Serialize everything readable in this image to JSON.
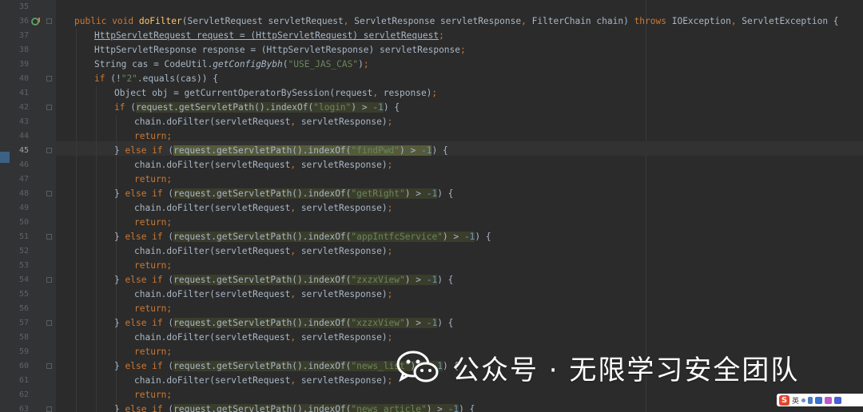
{
  "editor": {
    "current_line": "45",
    "lines": [
      {
        "n": "35",
        "indent": 0,
        "fold": false,
        "segs": []
      },
      {
        "n": "36",
        "indent": 1,
        "fold": true,
        "override": true,
        "segs": [
          {
            "t": "public void ",
            "c": "kw"
          },
          {
            "t": "doFilter",
            "c": "fn"
          },
          {
            "t": "(ServletRequest servletRequest"
          },
          {
            "t": ", ",
            "c": "kw"
          },
          {
            "t": "ServletResponse servletResponse"
          },
          {
            "t": ", ",
            "c": "kw"
          },
          {
            "t": "FilterChain chain) "
          },
          {
            "t": "throws ",
            "c": "kw"
          },
          {
            "t": "IOException"
          },
          {
            "t": ", ",
            "c": "kw"
          },
          {
            "t": "ServletException {"
          }
        ]
      },
      {
        "n": "37",
        "indent": 2,
        "fold": false,
        "segs": [
          {
            "t": "HttpServletRequest request = (HttpServletRequest) servletRequest",
            "c": "ul"
          },
          {
            "t": ";",
            "c": "kw"
          }
        ]
      },
      {
        "n": "38",
        "indent": 2,
        "fold": false,
        "segs": [
          {
            "t": "HttpServletResponse response = (HttpServletResponse) servletResponse"
          },
          {
            "t": ";",
            "c": "kw"
          }
        ]
      },
      {
        "n": "39",
        "indent": 2,
        "fold": false,
        "segs": [
          {
            "t": "String cas = CodeUtil."
          },
          {
            "t": "getConfigBybh",
            "c": "it"
          },
          {
            "t": "("
          },
          {
            "t": "\"USE_JAS_CAS\"",
            "c": "str"
          },
          {
            "t": ")"
          },
          {
            "t": ";",
            "c": "kw"
          }
        ]
      },
      {
        "n": "40",
        "indent": 2,
        "fold": true,
        "segs": [
          {
            "t": "if ",
            "c": "kw"
          },
          {
            "t": "(!"
          },
          {
            "t": "\"2\"",
            "c": "str"
          },
          {
            "t": ".equals(cas)) {"
          }
        ]
      },
      {
        "n": "41",
        "indent": 3,
        "fold": false,
        "segs": [
          {
            "t": "Object obj = getCurrentOperatorBySession(request"
          },
          {
            "t": ", ",
            "c": "kw"
          },
          {
            "t": "response)"
          },
          {
            "t": ";",
            "c": "kw"
          }
        ]
      },
      {
        "n": "42",
        "indent": 3,
        "fold": true,
        "segs": [
          {
            "t": "if ",
            "c": "kw"
          },
          {
            "t": "("
          },
          {
            "t": "request.getServletPath().indexOf(",
            "h": 1
          },
          {
            "t": "\"login\"",
            "c": "str",
            "h": 1
          },
          {
            "t": ") > ",
            "h": 1
          },
          {
            "t": "-1",
            "c": "num",
            "h": 1
          },
          {
            "t": ") {"
          }
        ]
      },
      {
        "n": "43",
        "indent": 4,
        "fold": false,
        "segs": [
          {
            "t": "chain.doFilter(servletRequest"
          },
          {
            "t": ", ",
            "c": "kw"
          },
          {
            "t": "servletResponse)"
          },
          {
            "t": ";",
            "c": "kw"
          }
        ]
      },
      {
        "n": "44",
        "indent": 4,
        "fold": false,
        "segs": [
          {
            "t": "return;",
            "c": "kw"
          }
        ]
      },
      {
        "n": "45",
        "indent": 3,
        "fold": true,
        "segs": [
          {
            "t": "} "
          },
          {
            "t": "else if ",
            "c": "kw"
          },
          {
            "t": "("
          },
          {
            "t": "request.getServletPath().indexOf(",
            "h": 1
          },
          {
            "t": "\"findPwd\"",
            "c": "str",
            "h": 1
          },
          {
            "t": ") > ",
            "h": 1
          },
          {
            "t": "-1",
            "c": "num",
            "h": 1
          },
          {
            "t": ") {"
          }
        ]
      },
      {
        "n": "46",
        "indent": 4,
        "fold": false,
        "segs": [
          {
            "t": "chain.doFilter(servletRequest"
          },
          {
            "t": ", ",
            "c": "kw"
          },
          {
            "t": "servletResponse)"
          },
          {
            "t": ";",
            "c": "kw"
          }
        ]
      },
      {
        "n": "47",
        "indent": 4,
        "fold": false,
        "segs": [
          {
            "t": "return;",
            "c": "kw"
          }
        ]
      },
      {
        "n": "48",
        "indent": 3,
        "fold": true,
        "segs": [
          {
            "t": "} "
          },
          {
            "t": "else if ",
            "c": "kw"
          },
          {
            "t": "("
          },
          {
            "t": "request.getServletPath().indexOf(",
            "h": 1
          },
          {
            "t": "\"getRight\"",
            "c": "str",
            "h": 1
          },
          {
            "t": ") > ",
            "h": 1
          },
          {
            "t": "-1",
            "c": "num",
            "h": 1
          },
          {
            "t": ") {"
          }
        ]
      },
      {
        "n": "49",
        "indent": 4,
        "fold": false,
        "segs": [
          {
            "t": "chain.doFilter(servletRequest"
          },
          {
            "t": ", ",
            "c": "kw"
          },
          {
            "t": "servletResponse)"
          },
          {
            "t": ";",
            "c": "kw"
          }
        ]
      },
      {
        "n": "50",
        "indent": 4,
        "fold": false,
        "segs": [
          {
            "t": "return;",
            "c": "kw"
          }
        ]
      },
      {
        "n": "51",
        "indent": 3,
        "fold": true,
        "segs": [
          {
            "t": "} "
          },
          {
            "t": "else if ",
            "c": "kw"
          },
          {
            "t": "("
          },
          {
            "t": "request.getServletPath().indexOf(",
            "h": 1
          },
          {
            "t": "\"appIntfcService\"",
            "c": "str",
            "h": 1
          },
          {
            "t": ") > ",
            "h": 1
          },
          {
            "t": "-1",
            "c": "num",
            "h": 1
          },
          {
            "t": ") {"
          }
        ]
      },
      {
        "n": "52",
        "indent": 4,
        "fold": false,
        "segs": [
          {
            "t": "chain.doFilter(servletRequest"
          },
          {
            "t": ", ",
            "c": "kw"
          },
          {
            "t": "servletResponse)"
          },
          {
            "t": ";",
            "c": "kw"
          }
        ]
      },
      {
        "n": "53",
        "indent": 4,
        "fold": false,
        "segs": [
          {
            "t": "return;",
            "c": "kw"
          }
        ]
      },
      {
        "n": "54",
        "indent": 3,
        "fold": true,
        "segs": [
          {
            "t": "} "
          },
          {
            "t": "else if ",
            "c": "kw"
          },
          {
            "t": "("
          },
          {
            "t": "request.getServletPath().indexOf(",
            "h": 1
          },
          {
            "t": "\"zxzxView\"",
            "c": "str",
            "h": 1
          },
          {
            "t": ") > ",
            "h": 1
          },
          {
            "t": "-1",
            "c": "num",
            "h": 1
          },
          {
            "t": ") {"
          }
        ]
      },
      {
        "n": "55",
        "indent": 4,
        "fold": false,
        "segs": [
          {
            "t": "chain.doFilter(servletRequest"
          },
          {
            "t": ", ",
            "c": "kw"
          },
          {
            "t": "servletResponse)"
          },
          {
            "t": ";",
            "c": "kw"
          }
        ]
      },
      {
        "n": "56",
        "indent": 4,
        "fold": false,
        "segs": [
          {
            "t": "return;",
            "c": "kw"
          }
        ]
      },
      {
        "n": "57",
        "indent": 3,
        "fold": true,
        "segs": [
          {
            "t": "} "
          },
          {
            "t": "else if ",
            "c": "kw"
          },
          {
            "t": "("
          },
          {
            "t": "request.getServletPath().indexOf(",
            "h": 1
          },
          {
            "t": "\"xzzxView\"",
            "c": "str",
            "h": 1
          },
          {
            "t": ") > ",
            "h": 1
          },
          {
            "t": "-1",
            "c": "num",
            "h": 1
          },
          {
            "t": ") {"
          }
        ]
      },
      {
        "n": "58",
        "indent": 4,
        "fold": false,
        "segs": [
          {
            "t": "chain.doFilter(servletRequest"
          },
          {
            "t": ", ",
            "c": "kw"
          },
          {
            "t": "servletResponse)"
          },
          {
            "t": ";",
            "c": "kw"
          }
        ]
      },
      {
        "n": "59",
        "indent": 4,
        "fold": false,
        "segs": [
          {
            "t": "return;",
            "c": "kw"
          }
        ]
      },
      {
        "n": "60",
        "indent": 3,
        "fold": true,
        "segs": [
          {
            "t": "} "
          },
          {
            "t": "else if ",
            "c": "kw"
          },
          {
            "t": "("
          },
          {
            "t": "request.getServletPath().indexOf(",
            "h": 1
          },
          {
            "t": "\"news_list\"",
            "c": "str",
            "h": 1
          },
          {
            "t": ") > ",
            "h": 1
          },
          {
            "t": "-1",
            "c": "num",
            "h": 1
          },
          {
            "t": ") {"
          }
        ]
      },
      {
        "n": "61",
        "indent": 4,
        "fold": false,
        "segs": [
          {
            "t": "chain.doFilter(servletRequest"
          },
          {
            "t": ", ",
            "c": "kw"
          },
          {
            "t": "servletResponse)"
          },
          {
            "t": ";",
            "c": "kw"
          }
        ]
      },
      {
        "n": "62",
        "indent": 4,
        "fold": false,
        "segs": [
          {
            "t": "return;",
            "c": "kw"
          }
        ]
      },
      {
        "n": "63",
        "indent": 3,
        "fold": true,
        "segs": [
          {
            "t": "} "
          },
          {
            "t": "else if ",
            "c": "kw"
          },
          {
            "t": "("
          },
          {
            "t": "request.getServletPath().indexOf(",
            "h": 1
          },
          {
            "t": "\"news_article\"",
            "c": "str",
            "h": 1
          },
          {
            "t": ") > ",
            "h": 1
          },
          {
            "t": "-1",
            "c": "num",
            "h": 1
          },
          {
            "t": ") {"
          }
        ]
      }
    ]
  },
  "watermark": {
    "text": "公众号 · 无限学习安全团队",
    "icon": "wechat-icon"
  },
  "ime_toolbar": {
    "logo": "S",
    "lang": "英",
    "icons": [
      "punctuation-icon",
      "microphone-icon",
      "keyboard-icon",
      "skin-icon",
      "tools-icon"
    ]
  },
  "colors": {
    "background": "#2b2b2b",
    "gutter": "#313335",
    "keyword": "#cc7832",
    "string": "#6a8759",
    "number": "#6897bb",
    "function": "#ffc66d",
    "text": "#a9b7c6",
    "highlight": "#3b3d2c"
  }
}
